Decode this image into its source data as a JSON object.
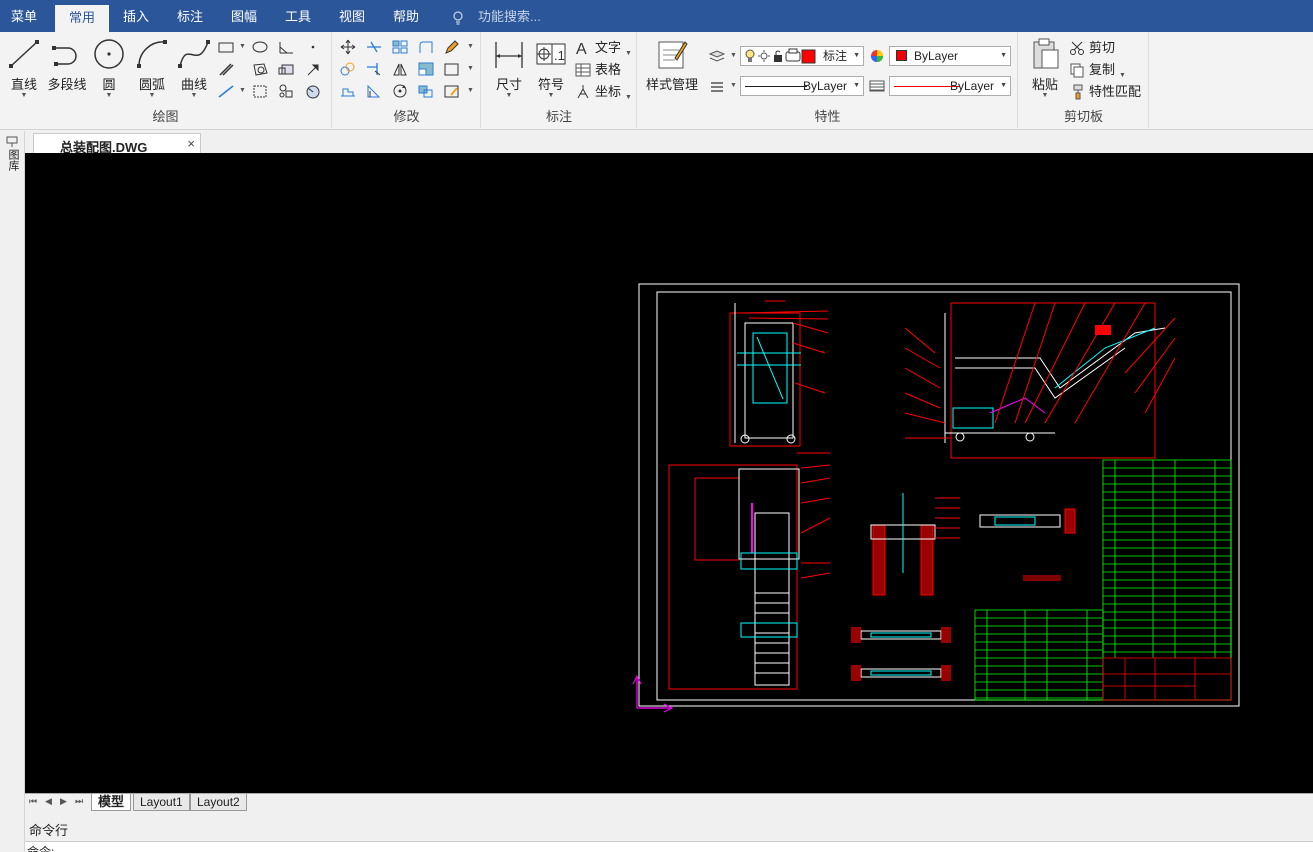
{
  "menu": {
    "items": [
      "菜单",
      "常用",
      "插入",
      "标注",
      "图幅",
      "工具",
      "视图",
      "帮助"
    ],
    "active": "常用",
    "search_placeholder": "功能搜索..."
  },
  "ribbon": {
    "draw": {
      "label": "绘图",
      "line": "直线",
      "polyline": "多段线",
      "circle": "圆",
      "arc": "圆弧",
      "curve": "曲线"
    },
    "modify": {
      "label": "修改"
    },
    "annotate": {
      "label": "标注",
      "dimension": "尺寸",
      "symbol": "符号",
      "text": "文字",
      "table": "表格",
      "coordinate": "坐标"
    },
    "properties": {
      "label": "特性",
      "style_manager": "样式管理",
      "layer_value": "标注",
      "color_value": "ByLayer",
      "linetype_value": "ByLayer",
      "lineweight_value": "ByLayer",
      "layer_color": "#ff0000"
    },
    "clipboard": {
      "label": "剪切板",
      "paste": "粘贴",
      "cut": "剪切",
      "copy": "复制",
      "match": "特性匹配"
    }
  },
  "side_palette": {
    "label": "图库"
  },
  "document": {
    "tab_title": "总装配图.DWG",
    "close": "×"
  },
  "layout_tabs": [
    "模型",
    "Layout1",
    "Layout2"
  ],
  "command": {
    "title": "命令行",
    "prompt": "命令:"
  },
  "colors": {
    "menu_bg": "#2b579a",
    "canvas_bg": "#000000",
    "drawing_red": "#ff0000",
    "drawing_white": "#ffffff",
    "drawing_cyan": "#00ffff",
    "drawing_green": "#00ff00",
    "drawing_magenta": "#ff00ff"
  }
}
